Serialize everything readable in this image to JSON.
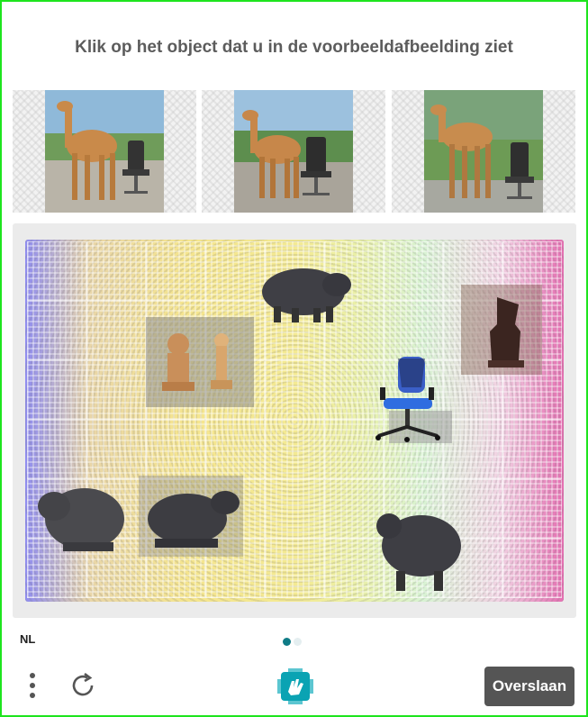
{
  "prompt": "Klik op het object dat u in de voorbeeldafbeelding ziet",
  "examples": [
    {
      "subject": "camel-and-office-chair"
    },
    {
      "subject": "camel-and-office-chair"
    },
    {
      "subject": "camel-and-office-chair"
    }
  ],
  "challenge_objects": [
    {
      "name": "capybara"
    },
    {
      "name": "chess-pieces"
    },
    {
      "name": "chess-piece"
    },
    {
      "name": "office-chair"
    },
    {
      "name": "capybara"
    },
    {
      "name": "capybara"
    },
    {
      "name": "capybara"
    }
  ],
  "footer": {
    "language": "NL",
    "pagination": {
      "current": 1,
      "total": 2
    },
    "skip_label": "Overslaan",
    "menu_icon": "vertical-dots-icon",
    "refresh_icon": "refresh-icon",
    "logo_icon": "hcaptcha-logo-icon"
  },
  "colors": {
    "frame_border": "#1ee51e",
    "accent": "#0f7b86",
    "skip_button_bg": "#555555",
    "prompt_text": "#5c5c5c"
  }
}
